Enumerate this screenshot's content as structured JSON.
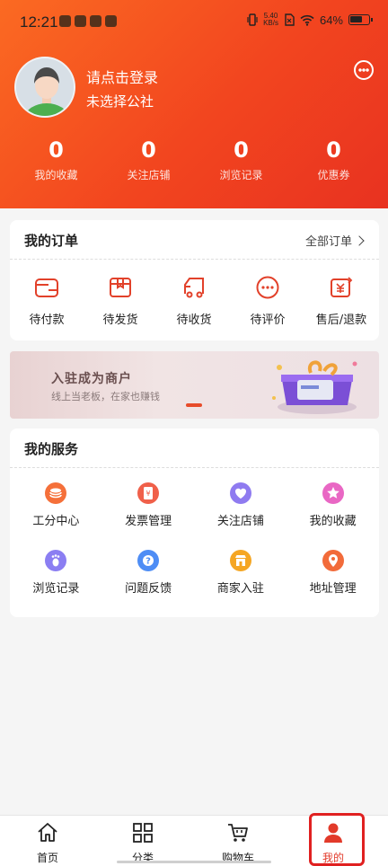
{
  "status_bar": {
    "time": "12:21",
    "speed_top": "5.40",
    "speed_bottom": "KB/s",
    "battery": "64%"
  },
  "profile": {
    "login_prompt": "请点击登录",
    "commune": "未选择公社"
  },
  "stats": [
    {
      "value": "0",
      "label": "我的收藏"
    },
    {
      "value": "0",
      "label": "关注店铺"
    },
    {
      "value": "0",
      "label": "浏览记录"
    },
    {
      "value": "0",
      "label": "优惠券"
    }
  ],
  "orders": {
    "title": "我的订单",
    "all_label": "全部订单",
    "items": [
      {
        "label": "待付款",
        "icon": "wallet-icon"
      },
      {
        "label": "待发货",
        "icon": "box-icon"
      },
      {
        "label": "待收货",
        "icon": "truck-icon"
      },
      {
        "label": "待评价",
        "icon": "comment-icon"
      },
      {
        "label": "售后/退款",
        "icon": "refund-icon"
      }
    ]
  },
  "banner": {
    "title": "入驻成为商户",
    "subtitle": "线上当老板，在家也赚钱"
  },
  "services": {
    "title": "我的服务",
    "items": [
      {
        "label": "工分中心",
        "icon": "coins-icon",
        "color": "#f5703a"
      },
      {
        "label": "发票管理",
        "icon": "invoice-icon",
        "color": "#f0604a"
      },
      {
        "label": "关注店铺",
        "icon": "heart-icon",
        "color": "#8f7bf0"
      },
      {
        "label": "我的收藏",
        "icon": "star-icon",
        "color": "#e967c4"
      },
      {
        "label": "浏览记录",
        "icon": "footprint-icon",
        "color": "#8b7ef2"
      },
      {
        "label": "问题反馈",
        "icon": "question-icon",
        "color": "#4e8df5"
      },
      {
        "label": "商家入驻",
        "icon": "shop-icon",
        "color": "#f5a623"
      },
      {
        "label": "地址管理",
        "icon": "location-icon",
        "color": "#f26b3a"
      }
    ]
  },
  "tabs": [
    {
      "label": "首页",
      "icon": "home-icon"
    },
    {
      "label": "分类",
      "icon": "category-icon"
    },
    {
      "label": "购物车",
      "icon": "cart-icon"
    },
    {
      "label": "我的",
      "icon": "user-icon"
    }
  ],
  "colors": {
    "accent": "#f2451f",
    "active_tab": "#e23a2a"
  }
}
